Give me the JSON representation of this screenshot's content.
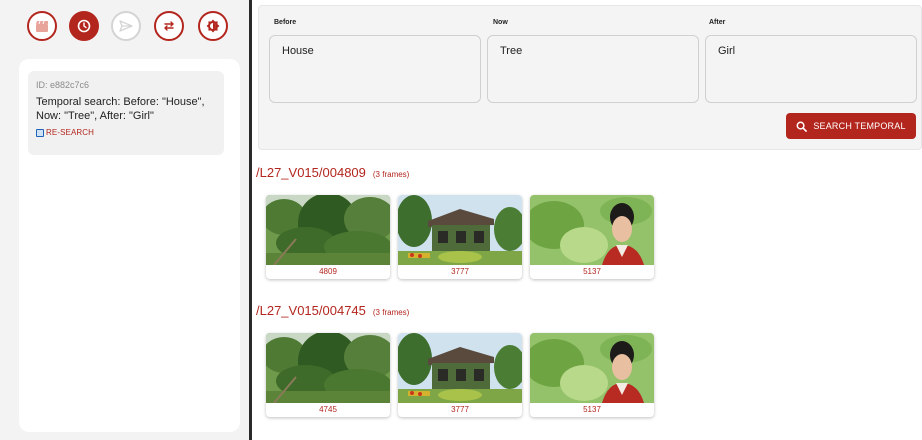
{
  "toolbar": {
    "buttons": [
      {
        "icon": "clapperboard-icon",
        "state": "idle"
      },
      {
        "icon": "clock-icon",
        "state": "active"
      },
      {
        "icon": "send-icon",
        "state": "disabled"
      },
      {
        "icon": "swap-arrows-icon",
        "state": "idle"
      },
      {
        "icon": "theme-toggle-icon",
        "state": "idle"
      }
    ],
    "accent": "#b3261e"
  },
  "history": {
    "items": [
      {
        "id": "ID: e882c7c6",
        "text": "Temporal search: Before: \"House\", Now: \"Tree\", After: \"Girl\"",
        "action": "RE-SEARCH"
      }
    ]
  },
  "search": {
    "before_label": "Before",
    "before_value": "House",
    "now_label": "Now",
    "now_value": "Tree",
    "after_label": "After",
    "after_value": "Girl",
    "submit_label": "SEARCH TEMPORAL"
  },
  "results": [
    {
      "video": "/L27_V015/004809",
      "count": "(3 frames)",
      "frames": [
        {
          "number": "4809",
          "scene": "trees"
        },
        {
          "number": "3777",
          "scene": "house"
        },
        {
          "number": "5137",
          "scene": "girl"
        }
      ]
    },
    {
      "video": "/L27_V015/004745",
      "count": "(3 frames)",
      "frames": [
        {
          "number": "4745",
          "scene": "trees"
        },
        {
          "number": "3777",
          "scene": "house"
        },
        {
          "number": "5137",
          "scene": "girl"
        }
      ]
    }
  ]
}
